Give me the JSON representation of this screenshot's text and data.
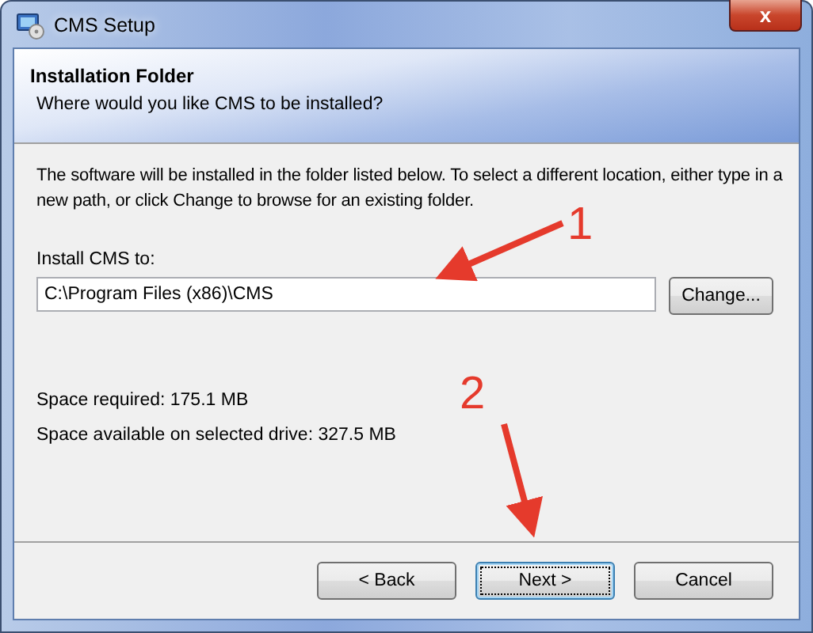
{
  "window": {
    "title": "CMS Setup",
    "close": "x"
  },
  "header": {
    "title": "Installation Folder",
    "subtitle": "Where would you like CMS to be installed?"
  },
  "description": "The software will be installed in the folder listed below. To select a different location, either type in a new path, or click Change to browse for an existing folder.",
  "install_field": {
    "label": "Install CMS to:",
    "value": "C:\\Program Files (x86)\\CMS",
    "button": "Change..."
  },
  "space": [
    "Space required: 175.1 MB",
    "Space available on selected drive: 327.5 MB"
  ],
  "buttons": [
    {
      "label": "< Back",
      "focused": false
    },
    {
      "label": "Next >",
      "focused": true
    },
    {
      "label": "Cancel",
      "focused": false
    }
  ],
  "annotations": [
    {
      "label": "1"
    },
    {
      "label": "2"
    }
  ]
}
